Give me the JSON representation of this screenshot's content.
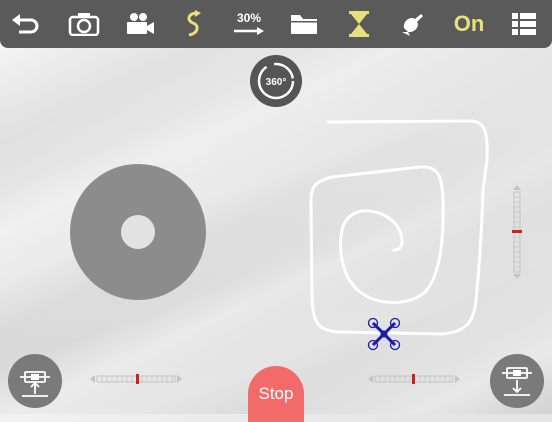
{
  "toolbar": {
    "speed_percent_label": "30%",
    "toggle_label": "On",
    "accent_color": "#e8e07a",
    "icons": [
      "back-arrow-icon",
      "camera-icon",
      "video-camera-icon",
      "trajectory-mode-icon",
      "speed-30-icon",
      "folder-icon",
      "hourglass-icon",
      "headless-mode-icon",
      "toggle-on",
      "menu-grid-icon"
    ]
  },
  "rotate_button": {
    "label": "360°"
  },
  "stop_button": {
    "label": "Stop",
    "color": "#f26a6a"
  },
  "bottom_left_button": {
    "icon": "takeoff-icon"
  },
  "bottom_right_button": {
    "icon": "landing-icon"
  },
  "trims": {
    "vertical_right": {
      "value": 0.5
    },
    "horizontal_left": {
      "value": 0.5
    },
    "horizontal_right": {
      "value": 0.5
    }
  },
  "drone_marker": {
    "icon": "drone-icon",
    "color": "#1a1ab0"
  }
}
